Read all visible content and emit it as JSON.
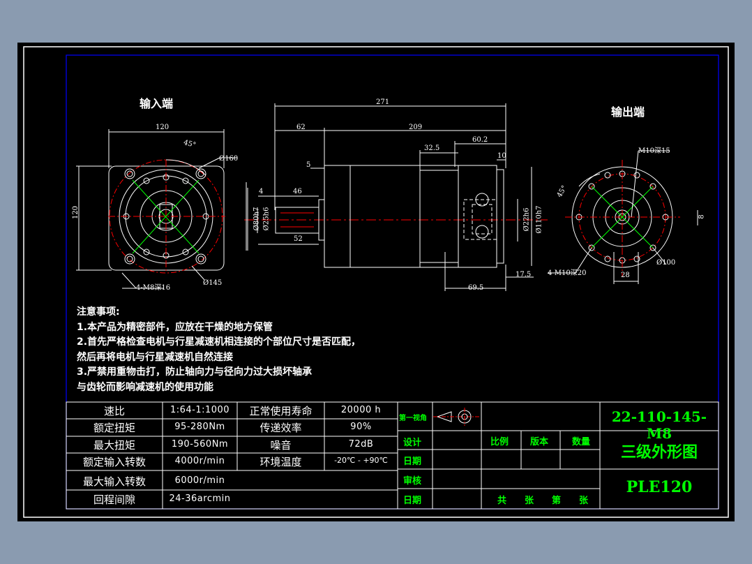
{
  "views": {
    "input_title": "输入端",
    "output_title": "输出端"
  },
  "dimensions": {
    "input": {
      "width_top": "120",
      "height_left": "120",
      "angle": "45°",
      "dia_160": "Ø160",
      "dia_145": "Ø145",
      "holes": "4-M8深16"
    },
    "side": {
      "overall": "271",
      "flange_len": "62",
      "body_len": "209",
      "len_32_5": "32.5",
      "len_60_2": "60.2",
      "len_5": "5",
      "len_10": "10",
      "key_4": "4",
      "key_46": "46",
      "key_52": "52",
      "len_17_5": "17.5",
      "len_69_5": "69.5",
      "dia_shaft": "Ø25h6",
      "dia_pilot": "Ø80h7",
      "dia_22": "Ø22h6",
      "dia_110": "Ø110h7"
    },
    "output": {
      "holes_top": "M10深15",
      "angle": "45°",
      "holes_bottom": "4-M10深20",
      "dia_100": "Ø100",
      "len_28": "28",
      "len_8": "8"
    }
  },
  "notes": {
    "heading": "注意事项:",
    "lines": [
      "1.本产品为精密部件，应放在干燥的地方保管",
      "2.首先严格检查电机与行星减速机相连接的个部位尺寸是否匹配，",
      "然后再将电机与行星减速机自然连接",
      "3.严禁用重物击打，防止轴向力与径向力过大损坏轴承",
      "与齿轮而影响减速机的使用功能"
    ]
  },
  "spec_table": {
    "rows": [
      {
        "label": "速比",
        "value": "1:64-1:1000",
        "label2": "正常使用寿命",
        "value2": "20000 h"
      },
      {
        "label": "额定扭矩",
        "value": "95-280Nm",
        "label2": "传递效率",
        "value2": "90%"
      },
      {
        "label": "最大扭矩",
        "value": "190-560Nm",
        "label2": "噪音",
        "value2": "72dB"
      },
      {
        "label": "额定输入转数",
        "value": "4000r/min",
        "label2": "环境温度",
        "value2": "-20℃ - +90℃"
      },
      {
        "label": "最大输入转数",
        "value": "6000r/min",
        "label2": "",
        "value2": ""
      },
      {
        "label": "回程间隙",
        "value": "24-36arcmin",
        "label2": "",
        "value2": ""
      }
    ]
  },
  "title_block": {
    "projection": "第一视角",
    "design": "设计",
    "date": "日期",
    "review": "审核",
    "date2": "日期",
    "scale": "比例",
    "version": "版本",
    "quantity": "数量",
    "total_sheets": "共　　张　　第　　张",
    "drawing_no": "22-110-145-M8",
    "drawing_name": "三级外形图",
    "model": "PLE120"
  },
  "colors": {
    "background": "#000000",
    "border_blue": "#0000ff",
    "line_white": "#ffffff",
    "text_green": "#00ff00",
    "center_red": "#ff0000"
  }
}
